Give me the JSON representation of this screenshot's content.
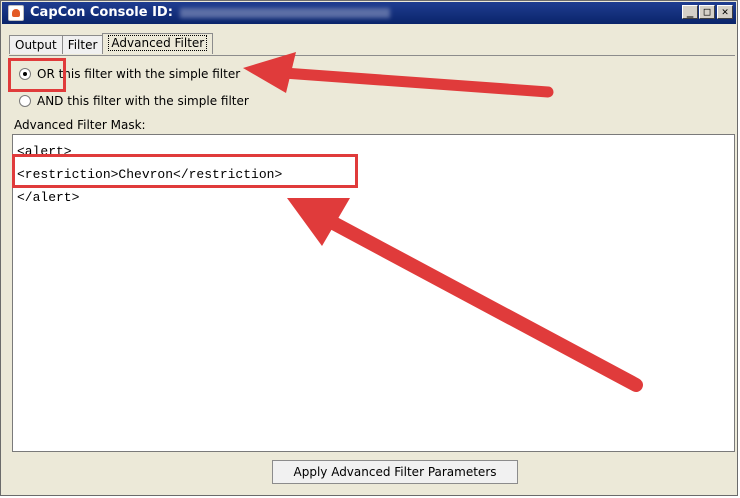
{
  "window": {
    "title": "CapCon Console ID:",
    "buttons": {
      "minimize": "_",
      "maximize": "□",
      "close": "✕"
    }
  },
  "tabs": [
    {
      "label": "Output"
    },
    {
      "label": "Filter"
    },
    {
      "label": "Advanced Filter",
      "active": true
    }
  ],
  "radios": [
    {
      "label": "OR this filter with the simple filter",
      "checked": true
    },
    {
      "label": "AND this filter with the simple filter",
      "checked": false
    }
  ],
  "mask": {
    "label": "Advanced Filter Mask:",
    "lines": [
      "<alert>",
      "<restriction>Chevron</restriction>",
      "</alert>"
    ]
  },
  "apply_button": {
    "label": "Apply Advanced Filter Parameters"
  },
  "annotation": {
    "color": "#e03b3b"
  }
}
